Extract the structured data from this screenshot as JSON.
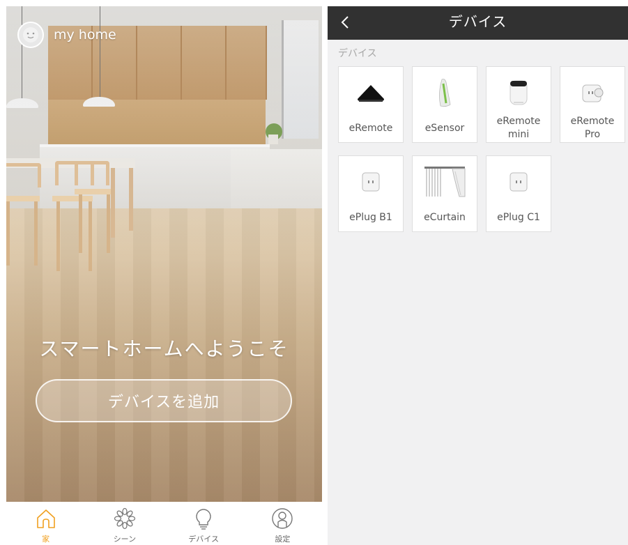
{
  "left_screen": {
    "home_name": "my home",
    "welcome_text": "スマートホームへようこそ",
    "add_device_label": "デバイスを追加",
    "tabs": [
      {
        "label": "家",
        "icon": "home-icon",
        "active": true
      },
      {
        "label": "シーン",
        "icon": "scene-icon",
        "active": false
      },
      {
        "label": "デバイス",
        "icon": "lightbulb-icon",
        "active": false
      },
      {
        "label": "設定",
        "icon": "settings-person-icon",
        "active": false
      }
    ]
  },
  "right_screen": {
    "title": "デバイス",
    "section_label": "デバイス",
    "devices": [
      {
        "label": "eRemote",
        "icon": "eremote-icon"
      },
      {
        "label": "eSensor",
        "icon": "esensor-icon"
      },
      {
        "label": "eRemote\nmini",
        "icon": "eremote-mini-icon"
      },
      {
        "label": "eRemote\nPro",
        "icon": "eremote-pro-icon"
      },
      {
        "label": "ePlug B1",
        "icon": "eplug-b1-icon"
      },
      {
        "label": "eCurtain",
        "icon": "ecurtain-icon"
      },
      {
        "label": "ePlug C1",
        "icon": "eplug-c1-icon"
      }
    ]
  },
  "colors": {
    "accent": "#f0a020",
    "navbar": "#313131",
    "background": "#f1f1f2"
  }
}
